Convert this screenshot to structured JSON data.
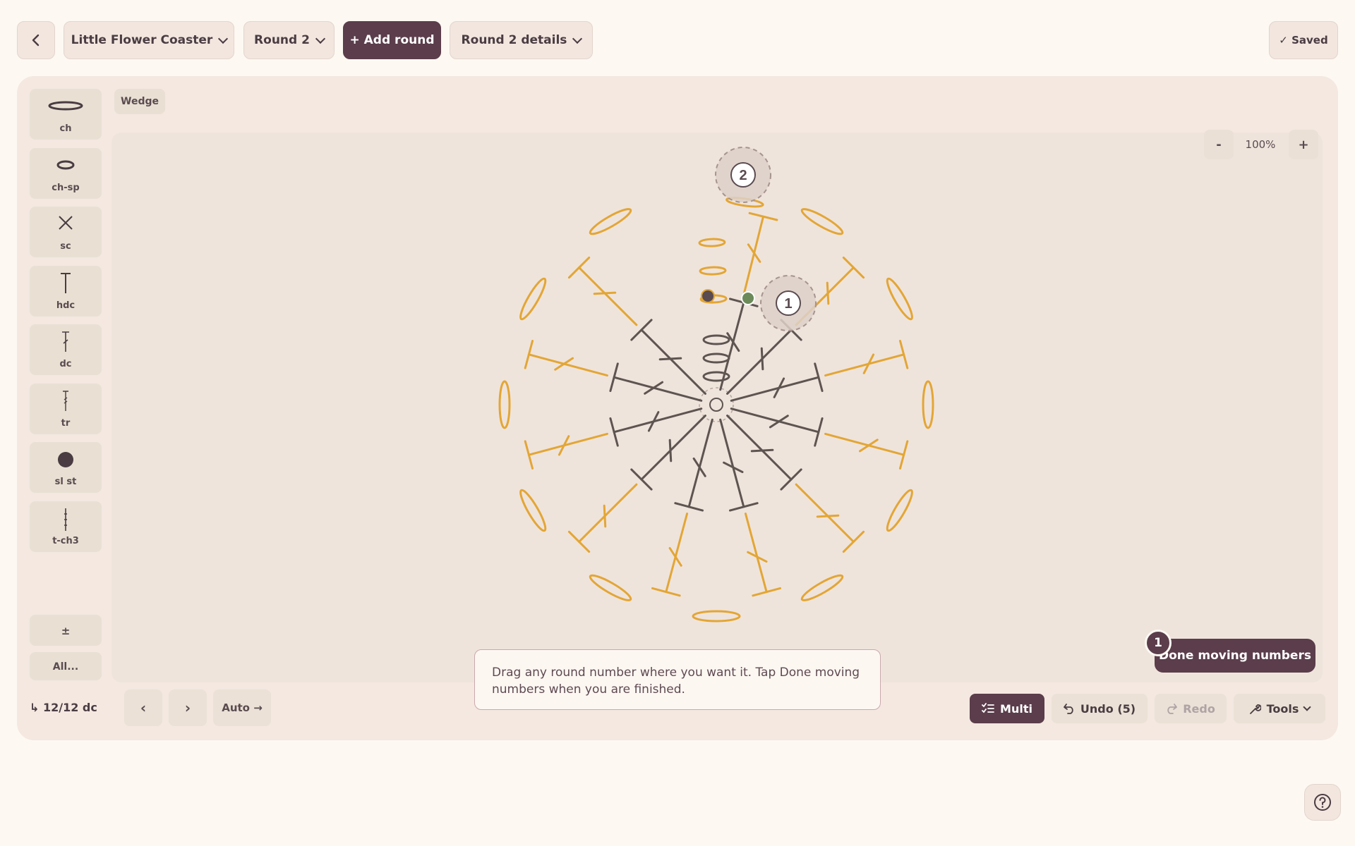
{
  "header": {
    "back_icon": "chevron-left-icon",
    "project_name": "Little Flower Coaster",
    "round_select": "Round 2",
    "add_round_label": "+ Add round",
    "round_details_label": "Round 2 details",
    "saved_label": "✓ Saved"
  },
  "palette": {
    "items": [
      {
        "label": "ch",
        "icon": "chain-icon"
      },
      {
        "label": "ch-sp",
        "icon": "chain-space-icon"
      },
      {
        "label": "sc",
        "icon": "single-crochet-icon"
      },
      {
        "label": "hdc",
        "icon": "half-double-crochet-icon"
      },
      {
        "label": "dc",
        "icon": "double-crochet-icon"
      },
      {
        "label": "tr",
        "icon": "treble-crochet-icon"
      },
      {
        "label": "sl st",
        "icon": "slip-stitch-icon"
      },
      {
        "label": "t-ch3",
        "icon": "turning-chain-icon"
      }
    ],
    "plus_minus_label": "±",
    "all_label": "All..."
  },
  "canvas": {
    "mode_tag": "Wedge",
    "zoom_out_label": "-",
    "zoom_level": "100%",
    "zoom_in_label": "+",
    "round_markers": [
      "2",
      "1"
    ],
    "stitch_colors": {
      "round1": "#5e5450",
      "round2": "#e3a635"
    }
  },
  "footer": {
    "stitch_count": "↳ 12/12 dc",
    "prev_label": "‹",
    "next_label": "›",
    "auto_label": "Auto →",
    "hint_text": "Drag any round number where you want it. Tap Done moving numbers when you are finished.",
    "done_badge": "1",
    "done_label": "Done moving numbers",
    "multi_label": "Multi",
    "undo_label": "Undo (5)",
    "redo_label": "Redo",
    "tools_label": "Tools"
  }
}
